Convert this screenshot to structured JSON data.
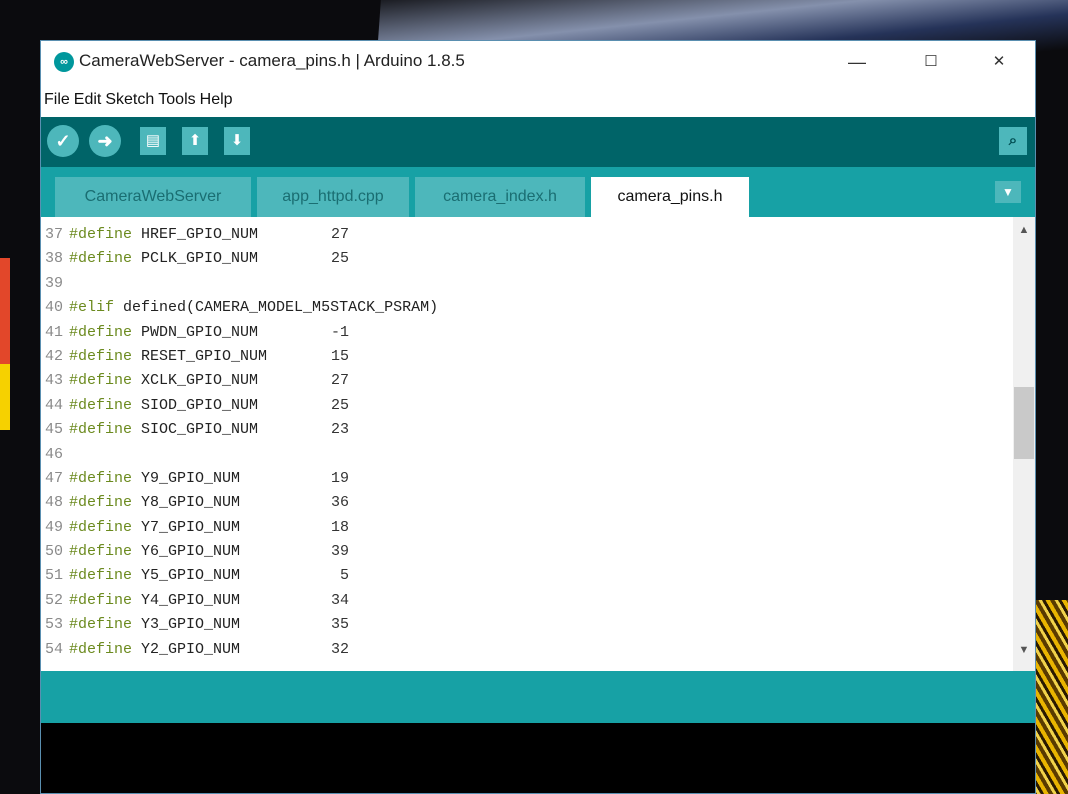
{
  "window": {
    "title": "CameraWebServer - camera_pins.h | Arduino 1.8.5",
    "logo_text": "∞",
    "controls": {
      "minimize": "—",
      "maximize": "☐",
      "close": "✕"
    }
  },
  "menu": [
    "File",
    "Edit",
    "Sketch",
    "Tools",
    "Help"
  ],
  "toolbar": {
    "verify_icon": "✓",
    "upload_icon": "➜",
    "new_icon": "▤",
    "open_icon": "⬆",
    "save_icon": "⬇",
    "serial_icon": "⌕"
  },
  "tabs": [
    {
      "label": "CameraWebServer",
      "active": false
    },
    {
      "label": "app_httpd.cpp",
      "active": false
    },
    {
      "label": "camera_index.h",
      "active": false
    },
    {
      "label": "camera_pins.h",
      "active": true
    }
  ],
  "tab_menu_icon": "▼",
  "code_lines": [
    {
      "n": "37",
      "kw": "#define",
      "name": "HREF_GPIO_NUM",
      "value": "27"
    },
    {
      "n": "38",
      "kw": "#define",
      "name": "PCLK_GPIO_NUM",
      "value": "25"
    },
    {
      "n": "39",
      "kw": "",
      "name": "",
      "value": ""
    },
    {
      "n": "40",
      "kw": "#elif",
      "name": "defined(CAMERA_MODEL_M5STACK_PSRAM)",
      "value": ""
    },
    {
      "n": "41",
      "kw": "#define",
      "name": "PWDN_GPIO_NUM",
      "value": "-1"
    },
    {
      "n": "42",
      "kw": "#define",
      "name": "RESET_GPIO_NUM",
      "value": "15"
    },
    {
      "n": "43",
      "kw": "#define",
      "name": "XCLK_GPIO_NUM",
      "value": "27"
    },
    {
      "n": "44",
      "kw": "#define",
      "name": "SIOD_GPIO_NUM",
      "value": "25"
    },
    {
      "n": "45",
      "kw": "#define",
      "name": "SIOC_GPIO_NUM",
      "value": "23"
    },
    {
      "n": "46",
      "kw": "",
      "name": "",
      "value": ""
    },
    {
      "n": "47",
      "kw": "#define",
      "name": "Y9_GPIO_NUM",
      "value": "19"
    },
    {
      "n": "48",
      "kw": "#define",
      "name": "Y8_GPIO_NUM",
      "value": "36"
    },
    {
      "n": "49",
      "kw": "#define",
      "name": "Y7_GPIO_NUM",
      "value": "18"
    },
    {
      "n": "50",
      "kw": "#define",
      "name": "Y6_GPIO_NUM",
      "value": "39"
    },
    {
      "n": "51",
      "kw": "#define",
      "name": "Y5_GPIO_NUM",
      "value": "5"
    },
    {
      "n": "52",
      "kw": "#define",
      "name": "Y4_GPIO_NUM",
      "value": "34"
    },
    {
      "n": "53",
      "kw": "#define",
      "name": "Y3_GPIO_NUM",
      "value": "35"
    },
    {
      "n": "54",
      "kw": "#define",
      "name": "Y2_GPIO_NUM",
      "value": "32"
    }
  ],
  "scrollbar": {
    "up_arrow": "▲",
    "down_arrow": "▼"
  },
  "colors": {
    "toolbar": "#006468",
    "tabbar": "#17a1a5",
    "button": "#4db7bb",
    "keyword": "#6b8a1e"
  }
}
